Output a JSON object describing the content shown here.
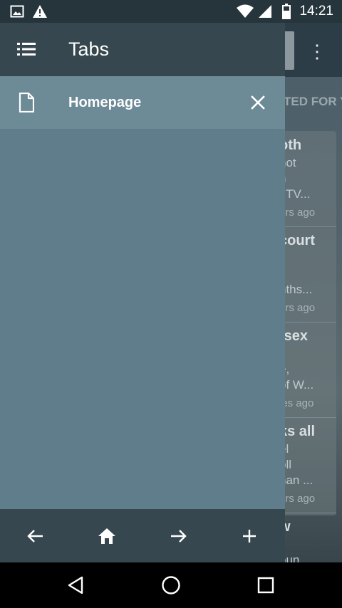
{
  "status_bar": {
    "time": "14:21",
    "icons": [
      "image-notification-icon",
      "warning-icon",
      "wifi-icon",
      "cell-signal-icon",
      "battery-icon"
    ]
  },
  "background_page": {
    "section_header": "TED FOR Y",
    "cards": [
      {
        "lines": [
          "oth",
          "not",
          "n",
          "t TV..."
        ],
        "age": "urs ago"
      },
      {
        "lines": [
          "court",
          "",
          "",
          "nths..."
        ],
        "age": "urs ago"
      },
      {
        "lines": [
          "-sex",
          "",
          "e,",
          "of W..."
        ],
        "age": "ies ago"
      },
      {
        "lines": [
          "ks all",
          "el",
          "oll",
          "han ..."
        ],
        "age": "urs ago"
      },
      {
        "lines": [
          "w",
          "",
          "oun"
        ],
        "age": ""
      }
    ],
    "overflow_icon": "more-vert-icon"
  },
  "drawer": {
    "title": "Tabs",
    "menu_icon": "list-icon",
    "tabs": [
      {
        "label": "Homepage",
        "icon": "document-icon",
        "close_icon": "close-icon"
      }
    ],
    "bottom_bar": [
      "back-arrow-icon",
      "home-icon",
      "forward-arrow-icon",
      "add-icon"
    ]
  },
  "system_nav": [
    "back-triangle-icon",
    "home-circle-icon",
    "recents-square-icon"
  ],
  "colors": {
    "drawer_body": "#607d8b",
    "drawer_header": "#37474f",
    "tab_selected": "#6d8a97",
    "status_bar": "#26343b"
  }
}
